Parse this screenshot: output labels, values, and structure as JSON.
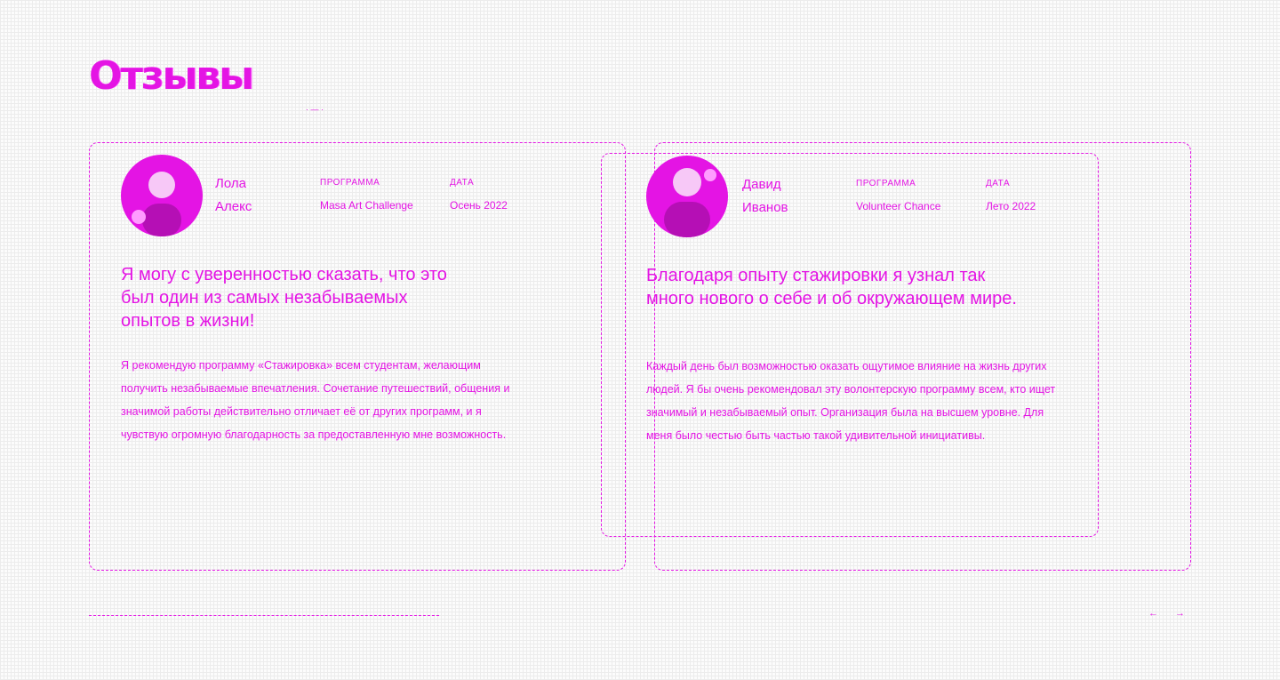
{
  "section": {
    "title": "Отзывы",
    "marker": "· — ·"
  },
  "reviews": [
    {
      "first_name": "Лола",
      "last_name": "Алекс",
      "program_label": "ПРОГРАММА",
      "program": "Masa Art Challenge",
      "date_label": "ДАТА",
      "date": "Осень 2022",
      "quote": "Я могу с уверенностью сказать, что это был один из самых незабываемых опытов в жизни!",
      "text": "Я рекомендую программу «Стажировка» всем студентам, желающим получить незабываемые впечатления. Сочетание путешествий, общения и значимой работы действительно отличает её от других программ, и я чувствую огромную благодарность за предоставленную мне возможность."
    },
    {
      "first_name": "Давид",
      "last_name": "Иванов",
      "program_label": "ПРОГРАММА",
      "program": "Volunteer Chance",
      "date_label": "ДАТА",
      "date": "Лето 2022",
      "quote": "Благодаря опыту стажировки я узнал так много нового о себе и об окружающем мире.",
      "text": "Каждый день был возможностью оказать ощутимое влияние на жизнь других людей. Я бы очень рекомендовал эту волонтерскую программу всем, кто ищет значимый и незабываемый опыт. Организация была на высшем уровне. Для меня было честью быть частью такой удивительной инициативы."
    }
  ],
  "nav": {
    "prev": "←",
    "next": "→"
  },
  "colors": {
    "accent": "#e414e4",
    "background": "#fcfcfc"
  }
}
